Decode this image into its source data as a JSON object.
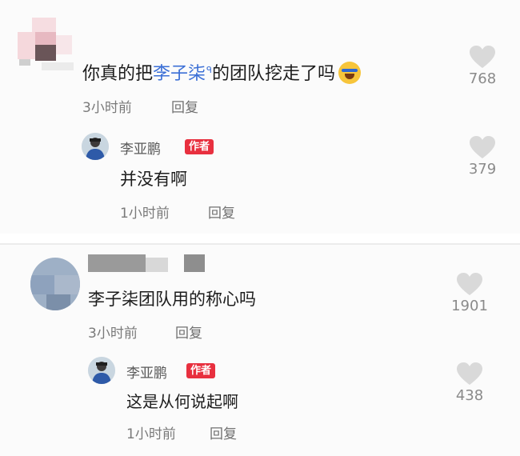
{
  "comments": [
    {
      "text_before": "你真的把",
      "mention": "李子柒",
      "mention_symbol": "ᑫ",
      "text_after": "的团队挖走了吗",
      "emoji": "rofl-emoji",
      "time": "3小时前",
      "reply_label": "回复",
      "likes": "768",
      "reply": {
        "author": "李亚鹏",
        "badge": "作者",
        "text": "并没有啊",
        "time": "1小时前",
        "reply_label": "回复",
        "likes": "379"
      }
    },
    {
      "text": "李子柒团队用的称心吗",
      "time": "3小时前",
      "reply_label": "回复",
      "likes": "1901",
      "reply": {
        "author": "李亚鹏",
        "badge": "作者",
        "text": "这是从何说起啊",
        "time": "1小时前",
        "reply_label": "回复",
        "likes": "438"
      }
    }
  ],
  "colors": {
    "accent_mention": "#3b6fd6",
    "badge": "#e8303f",
    "like_icon": "#d9d9d9"
  }
}
